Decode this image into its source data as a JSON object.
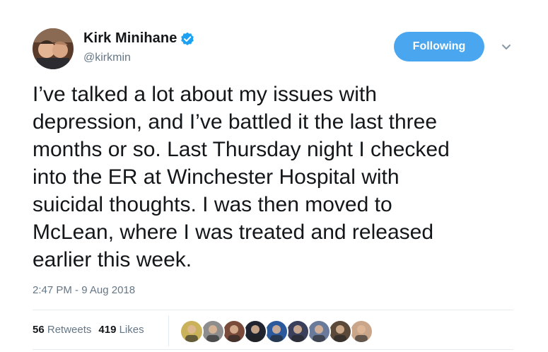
{
  "user": {
    "display_name": "Kirk Minihane",
    "handle": "@kirkmin",
    "verified": true
  },
  "follow_button": {
    "label": "Following"
  },
  "menu": {
    "icon": "chevron-down-icon"
  },
  "tweet": {
    "text": "I’ve talked a lot about my issues with\ndepression, and I’ve battled it the last three\nmonths or so. Last Thursday night I checked\ninto the ER at Winchester Hospital with\nsuicidal thoughts. I was then moved to\nMcLean, where I was treated and released\nearlier this week.",
    "timestamp": "2:47 PM - 9 Aug 2018"
  },
  "stats": {
    "retweets_count": "56",
    "retweets_label": "Retweets",
    "likes_count": "419",
    "likes_label": "Likes"
  },
  "likers": [
    {
      "color": "#c9b25a"
    },
    {
      "color": "#8d8d8d"
    },
    {
      "color": "#7a4a3a"
    },
    {
      "color": "#1f2430"
    },
    {
      "color": "#2a5a9c"
    },
    {
      "color": "#3a3f5c"
    },
    {
      "color": "#6a7a9a"
    },
    {
      "color": "#5b4a3a"
    },
    {
      "color": "#c9a68a"
    }
  ],
  "colors": {
    "accent": "#4aa7ef",
    "verified": "#1da1f2",
    "secondary_text": "#657786"
  }
}
